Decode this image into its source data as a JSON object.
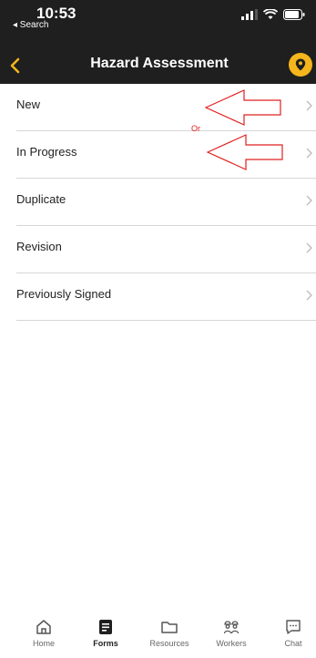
{
  "status_bar": {
    "time": "10:53",
    "back_label": "◂ Search"
  },
  "header": {
    "title": "Hazard Assessment",
    "back_icon": "chevron-left-icon",
    "action_icon": "location-pin-icon",
    "accent": "#f5b51c"
  },
  "list": {
    "items": [
      {
        "label": "New"
      },
      {
        "label": "In Progress"
      },
      {
        "label": "Duplicate"
      },
      {
        "label": "Revision"
      },
      {
        "label": "Previously Signed"
      }
    ]
  },
  "annotation": {
    "or_label": "Or",
    "color": "#e02020"
  },
  "tabbar": {
    "tabs": [
      {
        "label": "Home",
        "icon": "home-icon"
      },
      {
        "label": "Forms",
        "icon": "forms-icon",
        "active": true
      },
      {
        "label": "Resources",
        "icon": "folder-icon"
      },
      {
        "label": "Workers",
        "icon": "workers-icon"
      },
      {
        "label": "Chat",
        "icon": "chat-icon"
      }
    ]
  }
}
